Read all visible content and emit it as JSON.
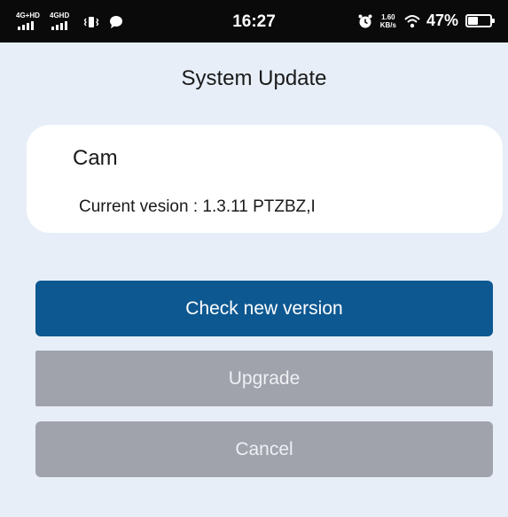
{
  "status_bar": {
    "net1_label": "4G+HD",
    "net2_label": "4GHD",
    "time": "16:27",
    "speed_value": "1.60",
    "speed_unit": "KB/s",
    "battery_percent": "47%",
    "battery_level": 0.47,
    "icons": [
      "signal-icon",
      "vibrate-icon",
      "chat-icon",
      "alarm-icon",
      "wifi-icon",
      "battery-icon"
    ]
  },
  "header": {
    "title": "System Update"
  },
  "device": {
    "name": "Cam",
    "version_label": "Current vesion : ",
    "version_value": "1.3.11 PTZBZ,I"
  },
  "actions": {
    "check_label": "Check new version",
    "upgrade_label": "Upgrade",
    "cancel_label": "Cancel"
  },
  "colors": {
    "background": "#e7eef8",
    "primary": "#0d5891",
    "disabled": "#a0a2ac",
    "status_bar": "#0a0a0a"
  }
}
